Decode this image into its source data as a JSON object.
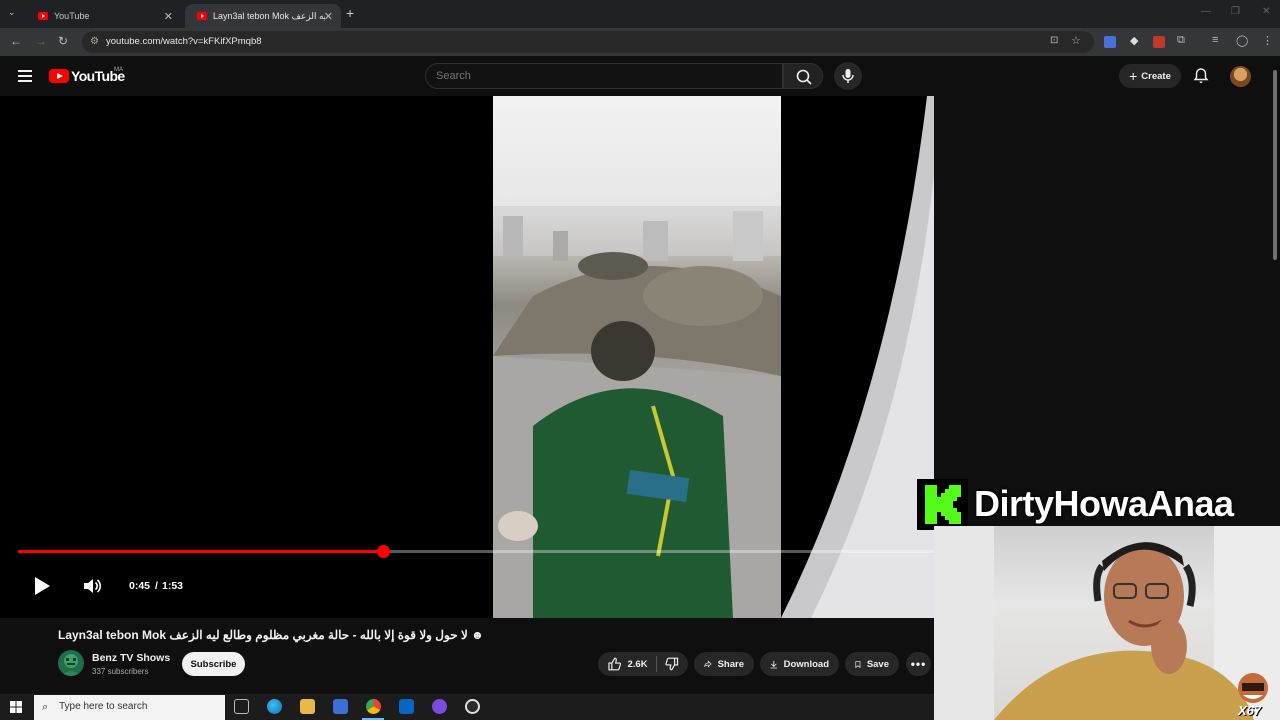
{
  "browser": {
    "tabs": [
      {
        "label": "YouTube"
      },
      {
        "label": "Layn3al tebon Mok لا حول ولا قوة إلا بالله - حالة مغربي مظلوم وطالع ليه الزعف"
      }
    ],
    "url": "youtube.com/watch?v=kFKifXPmqb8"
  },
  "youtube": {
    "logo_text": "YouTube",
    "country_code": "MA",
    "search_placeholder": "Search",
    "create_label": "Create"
  },
  "player": {
    "current_time": "0:45",
    "separator": "/",
    "duration": "1:53",
    "progress_fraction": 0.398
  },
  "video": {
    "title": "Layn3al tebon Mok لا حول ولا قوة إلا بالله - حالة مغربي مظلوم وطالع ليه الزعف ☻",
    "channel_name": "Benz TV Shows",
    "subscribers": "337 subscribers",
    "subscribe_label": "Subscribe",
    "likes": "2.6K",
    "share_label": "Share",
    "download_label": "Download",
    "save_label": "Save"
  },
  "overlay": {
    "streamer_name": "DirtyHowaAnaa",
    "badge_count": "X67",
    "brand_color": "#53fc18"
  },
  "taskbar": {
    "search_placeholder": "Type here to search"
  }
}
